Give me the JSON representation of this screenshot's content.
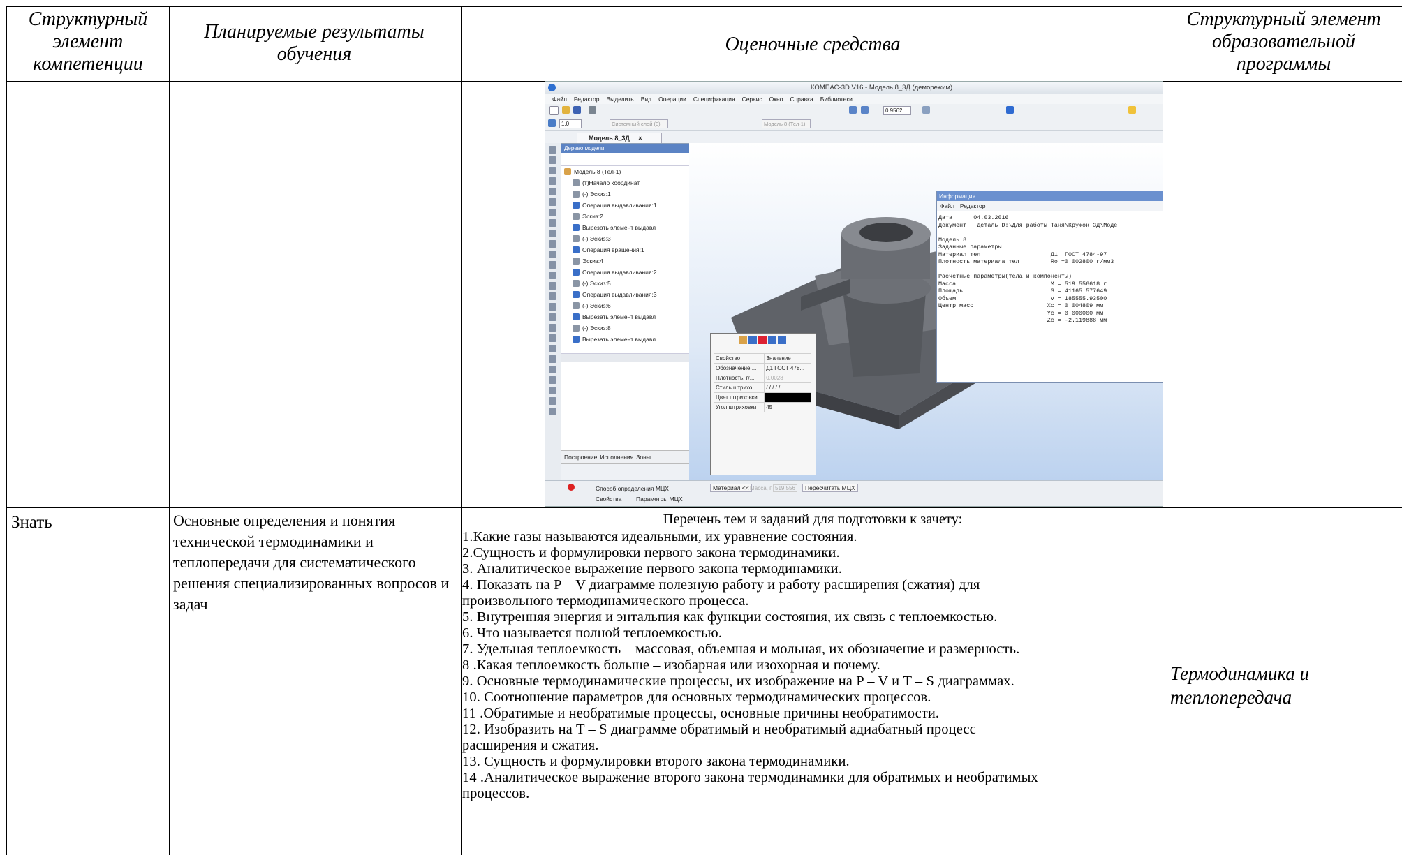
{
  "header": {
    "col1": "Структурный элемент компетенции",
    "col2": "Планируемые результаты обучения",
    "col3": "Оценочные средства",
    "col4": "Структурный элемент образовательной программы"
  },
  "row2": {
    "competence": "Знать",
    "results": "Основные определения и понятия технической термодинамики и теплопередачи для систематического решения специализированных вопросов и задач",
    "list_title": "Перечень тем и заданий для подготовки к зачету:",
    "topics": [
      "1.Какие газы называются идеальными, их уравнение состояния.",
      "2.Сущность и формулировки первого закона термодинамики.",
      "3. Аналитическое выражение первого закона термодинамики.",
      "4. Показать на P – V диаграмме полезную работу и работу расширения (сжатия) для",
      "произвольного  термодинамического процесса.",
      "5. Внутренняя энергия и энтальпия как функции состояния, их связь с теплоемкостью.",
      "6. Что называется полной теплоемкостью.",
      "7. Удельная теплоемкость – массовая, объемная и мольная, их обозначение и размерность.",
      "8 .Какая теплоемкость больше – изобарная  или изохорная и почему.",
      "9. Основные термодинамические процессы, их изображение на P – V и T – S диаграммах.",
      "10. Соотношение параметров для основных термодинамических процессов.",
      "11 .Обратимые и необратимые процессы, основные причины необратимости.",
      "12. Изобразить на T – S диаграмме  обратимый и необратимый адиабатный процесс",
      "расширения и сжатия.",
      "13. Сущность и формулировки второго закона термодинамики.",
      "14 .Аналитическое выражение второго закона термодинамики для обратимых  и необратимых",
      "процессов."
    ],
    "program_element": "Термодинамика и теплопередача"
  },
  "screenshot": {
    "title": "КОМПАС-3D V16  - Модель 8_3Д (деморежим)",
    "menu": [
      "Файл",
      "Редактор",
      "Выделить",
      "Вид",
      "Операции",
      "Спецификация",
      "Сервис",
      "Окно",
      "Справка",
      "Библиотеки"
    ],
    "zoom": "0.9562",
    "step": "1.0",
    "layer": "Системный слой (0)",
    "model_select": "Модель 8 (Тел-1)",
    "tab": "Модель 8_3Д",
    "tree_title": "Дерево модели",
    "tree_root": "Модель 8 (Тел-1)",
    "tree_items": [
      "(т)Начало координат",
      "(-) Эскиз:1",
      "Операция выдавливания:1",
      "Эскиз:2",
      "Вырезать элемент выдавл",
      "(-) Эскиз:3",
      "Операция вращения:1",
      "Эскиз:4",
      "Операция выдавливания:2",
      "(-) Эскиз:5",
      "Операция выдавливания:3",
      "(-) Эскиз:6",
      "Вырезать элемент выдавл",
      "(-) Эскиз:8",
      "Вырезать элемент выдавл"
    ],
    "tree_tabs": [
      "Построение",
      "Исполнения",
      "Зоны"
    ],
    "info_title": "Информация",
    "info_menu": [
      "Файл",
      "Редактор"
    ],
    "info_lines": [
      "Дата      04.03.2016",
      "Документ   Деталь D:\\Для работы Таня\\Кружок 3Д\\Моде",
      "",
      "Модель 8",
      "Заданные параметры",
      "Материал тел                    Д1  ГОСТ 4784-97",
      "Плотность материала тел         Ro =0.002800 г/мм3",
      "",
      "Расчетные параметры(тела и компоненты)",
      "Масса                           M = 519.556618 г",
      "Площадь                         S = 41165.577649",
      "Объем                           V = 185555.93500",
      "Центр масс                     Xc = 0.004809 мм",
      "                               Yc = 0.000000 мм",
      "                               Zc = -2.119888 мм"
    ],
    "props_head": [
      "Свойство",
      "Значение"
    ],
    "props_rows": [
      [
        "Обозначение ...",
        "Д1 ГОСТ 478..."
      ],
      [
        "Плотность, г/...",
        "0.0028"
      ],
      [
        "Стиль штрихо...",
        "/ / / / /"
      ],
      [
        "Цвет штриховки",
        ""
      ],
      [
        "Угол штриховки",
        "45"
      ]
    ],
    "status_method": "Способ определения МЦХ",
    "status_material": "Материал  <<",
    "status_mass_label": "Масса, г",
    "status_mass_value": "519.556",
    "status_recalc": "Пересчитать МЦХ",
    "status_tabs": [
      "Свойства",
      "Параметры МЦХ"
    ]
  }
}
